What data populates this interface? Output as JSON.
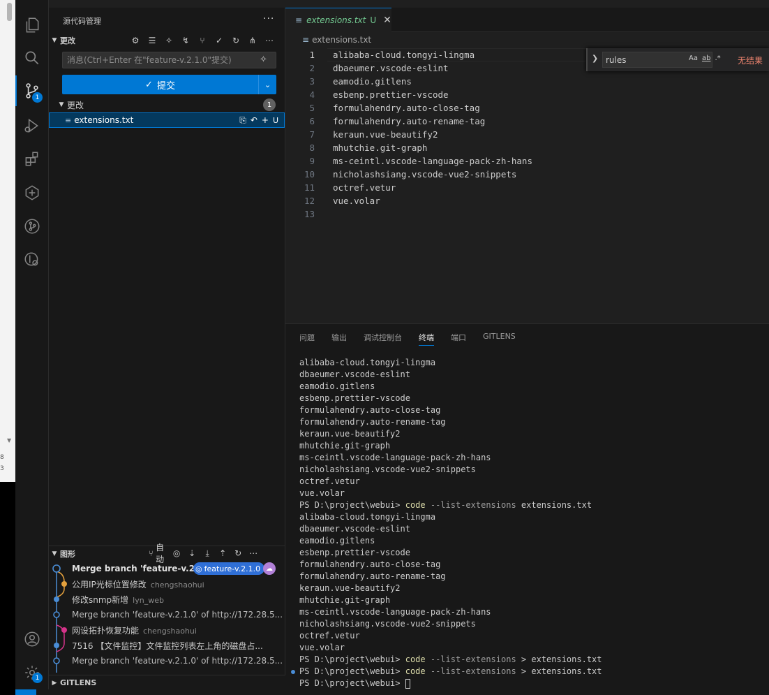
{
  "sidebar": {
    "title": "源代码管理",
    "changes_section": "更改",
    "message_placeholder": "消息(Ctrl+Enter 在\"feature-v.2.1.0\"提交)",
    "commit_label": "提交",
    "changes_group": "更改",
    "changes_count": "1",
    "file_name": "extensions.txt",
    "file_status": "U",
    "graph_section": "图形",
    "graph_auto": "自动",
    "gitlens_section": "GITLENS"
  },
  "graph": {
    "branch": "feature-v.2.1.0",
    "commits": [
      {
        "message": "Merge branch 'feature-v.2....",
        "author": "",
        "color": "#4a8dd6"
      },
      {
        "message": "公用IP光标位置修改",
        "author": "chengshaohui",
        "color": "#e5a13d"
      },
      {
        "message": "修改snmp新增",
        "author": "lyn_web",
        "color": "#4a8dd6"
      },
      {
        "message": "Merge branch 'feature-v.2.1.0' of http://172.28.5...",
        "author": "",
        "color": "#4a8dd6"
      },
      {
        "message": "网设拓扑恢复功能",
        "author": "chengshaohui",
        "color": "#d6338a"
      },
      {
        "message": "7516 【文件监控】文件监控列表左上角的磁盘占...",
        "author": "",
        "color": "#4a8dd6"
      },
      {
        "message": "Merge branch 'feature-v.2.1.0' of http://172.28.5...",
        "author": "",
        "color": "#4a8dd6"
      }
    ]
  },
  "activity": {
    "scm_badge": "1",
    "settings_badge": "1"
  },
  "editor": {
    "tab_name": "extensions.txt",
    "tab_status": "U",
    "breadcrumb": "extensions.txt",
    "lines": [
      "alibaba-cloud.tongyi-lingma",
      "dbaeumer.vscode-eslint",
      "eamodio.gitlens",
      "esbenp.prettier-vscode",
      "formulahendry.auto-close-tag",
      "formulahendry.auto-rename-tag",
      "keraun.vue-beautify2",
      "mhutchie.git-graph",
      "ms-ceintl.vscode-language-pack-zh-hans",
      "nicholashsiang.vscode-vue2-snippets",
      "octref.vetur",
      "vue.volar",
      ""
    ]
  },
  "find": {
    "value": "rules",
    "opt_case": "Aa",
    "opt_word": "ab",
    "opt_regex": ".*",
    "result": "无结果"
  },
  "panel": {
    "tabs": [
      "问题",
      "输出",
      "调试控制台",
      "终端",
      "端口",
      "GITLENS"
    ],
    "active_tab": "终端",
    "prompt": "PS D:\\project\\webui> ",
    "command": "code",
    "flag": " --list-extensions",
    "cmd1_rest": " extensions.txt",
    "cmd2_rest": " > extensions.txt",
    "extensions": [
      "alibaba-cloud.tongyi-lingma",
      "dbaeumer.vscode-eslint",
      "eamodio.gitlens",
      "esbenp.prettier-vscode",
      "formulahendry.auto-close-tag",
      "formulahendry.auto-rename-tag",
      "keraun.vue-beautify2",
      "mhutchie.git-graph",
      "ms-ceintl.vscode-language-pack-zh-hans",
      "nicholashsiang.vscode-vue2-snippets",
      "octref.vetur",
      "vue.volar"
    ]
  },
  "outer": {
    "num1": "8",
    "num2": "3"
  },
  "colors": {
    "accent": "#0078d4",
    "untracked": "#73c991",
    "no_result": "#f48771"
  }
}
